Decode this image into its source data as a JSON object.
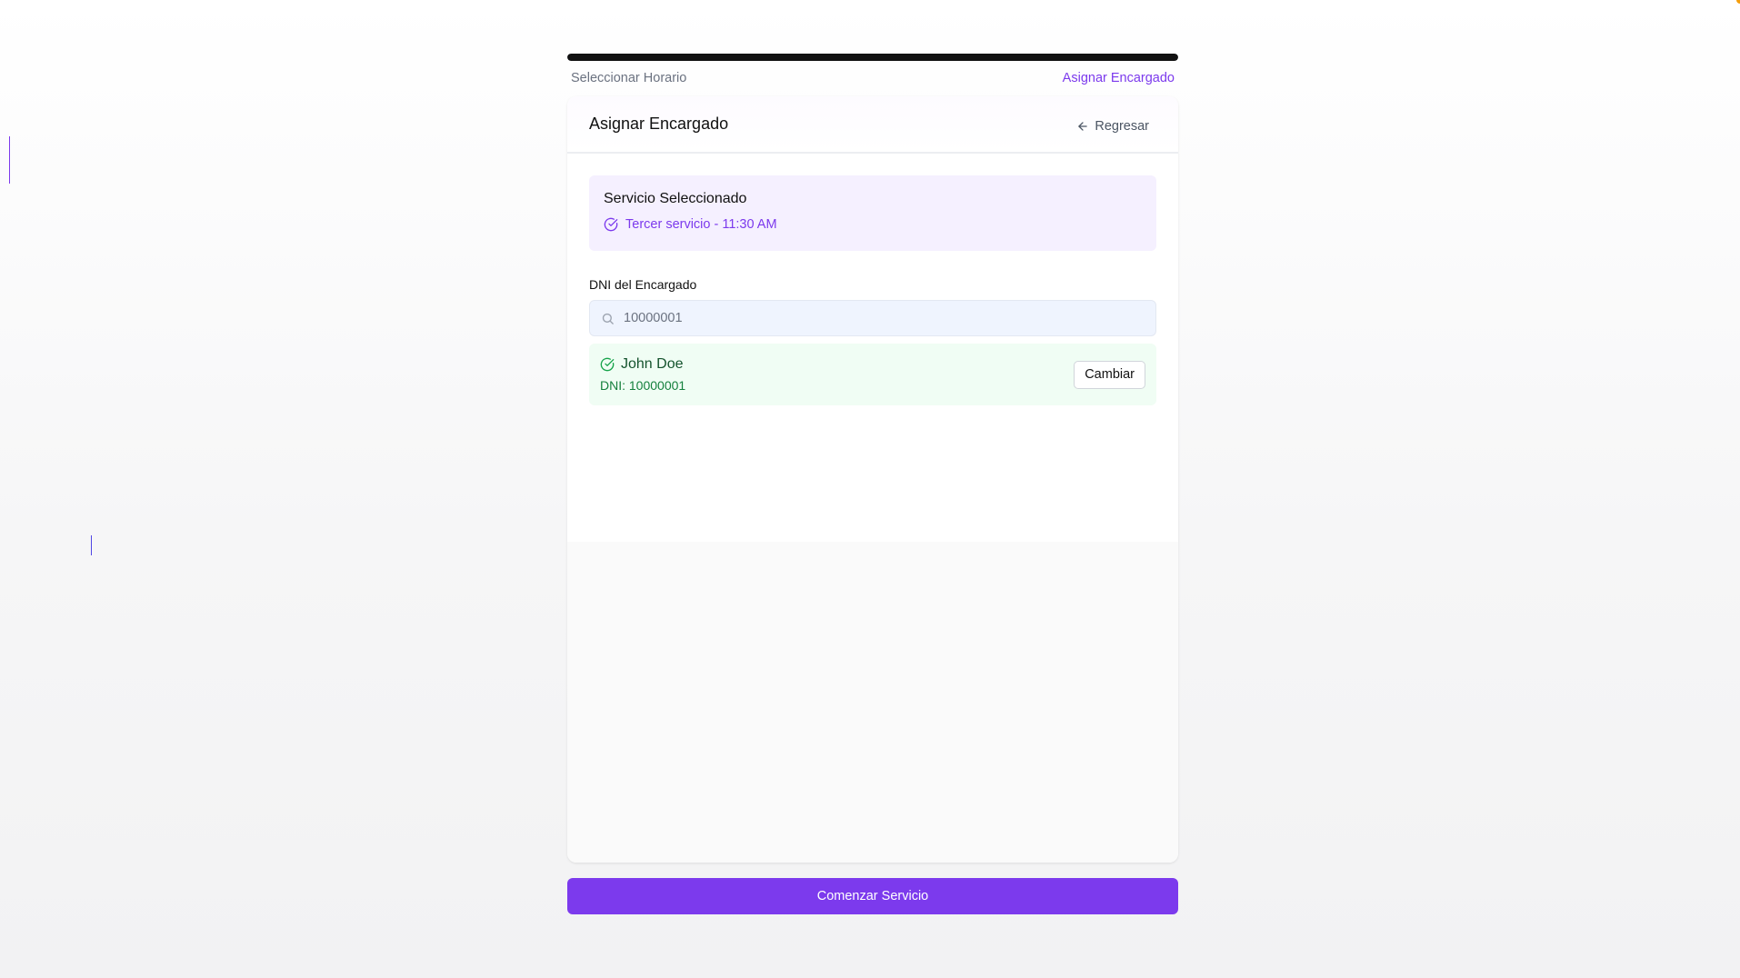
{
  "progress": {
    "percent": 100
  },
  "steps": [
    {
      "label": "Seleccionar Horario",
      "active": false
    },
    {
      "label": "Asignar Encargado",
      "active": true
    }
  ],
  "card": {
    "title": "Asignar Encargado",
    "back_label": "Regresar"
  },
  "service": {
    "heading": "Servicio Seleccionado",
    "selection": "Tercer servicio - 11:30 AM"
  },
  "dni_field": {
    "label": "DNI del Encargado",
    "value": "10000001"
  },
  "person": {
    "name": "John Doe",
    "dni_text": "DNI: 10000001",
    "change_label": "Cambiar"
  },
  "footer": {
    "primary_label": "Comenzar Servicio"
  },
  "colors": {
    "accent": "#7c3aed",
    "progress": "#111111",
    "success_bg": "#f0fdf4",
    "success_text": "#15803d",
    "service_bg": "#f5f0ff"
  },
  "icons": [
    "arrow-left-icon",
    "check-circle-icon",
    "search-icon"
  ]
}
